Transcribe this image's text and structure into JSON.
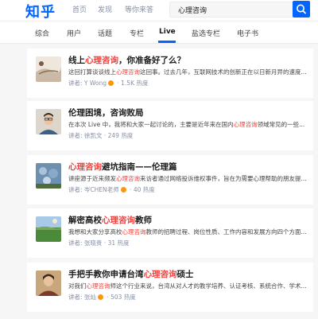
{
  "header": {
    "logo": "知乎",
    "nav": [
      "首页",
      "发现",
      "等你来答"
    ],
    "search": {
      "value": "心理咨询"
    }
  },
  "tabs": [
    "综合",
    "用户",
    "话题",
    "专栏",
    "Live",
    "盐选专栏",
    "电子书"
  ],
  "active_tab": "Live",
  "meta_labels": {
    "speaker_prefix": "讲者:",
    "dot": "·",
    "heat_suffix": "热度"
  },
  "results": [
    {
      "title_pre": "线上",
      "title_hl": "心理咨询",
      "title_post": "，你准备好了么？",
      "desc_pre": "这回打算谈谈线上",
      "desc_hl": "心理咨询",
      "desc_post": "这回事。过去几年，互联网技术的创新正在以日新月异的速度...",
      "speaker": "Y Wong",
      "badge": true,
      "heat": "1.5K",
      "thumb_icon": "curve-landscape-icon"
    },
    {
      "title_pre": "伦理困境，咨询败局",
      "title_hl": "",
      "title_post": "",
      "desc_pre": "在本次 Live 中，我将和大家一起讨论的，主要是近年来在国内",
      "desc_hl": "心理咨询",
      "desc_post": "领域常见的一些...",
      "speaker": "徐凯文",
      "badge": false,
      "heat": "249",
      "thumb_icon": "man-portrait-icon"
    },
    {
      "title_pre": "",
      "title_hl": "心理咨询",
      "title_post": "避坑指南——伦理篇",
      "desc_pre": "讲座源于近来频发",
      "desc_hl": "心理咨询",
      "desc_post": "来访者通过网络投诉维权事件，旨在为需要心理帮助的朋友提...",
      "speaker": "岑CHEN老师",
      "badge": true,
      "heat": "40",
      "thumb_icon": "blue-flowers-icon"
    },
    {
      "title_pre": "解密高校",
      "title_hl": "心理咨询",
      "title_post": "教师",
      "desc_pre": "我想和大家分享高校",
      "desc_hl": "心理咨询",
      "desc_post": "教师的招聘过程、岗位性质、工作内容和发展方向四个方面...",
      "speaker": "张晓贵",
      "badge": false,
      "heat": "31",
      "thumb_icon": "green-field-icon"
    },
    {
      "title_pre": "手把手教你申请台湾",
      "title_hl": "心理咨询",
      "title_post": "硕士",
      "desc_pre": "对我们",
      "desc_hl": "心理咨询",
      "desc_post": "师这个行业来说，台湾从对人才的教学培养、认证考核、系统合作、学术...",
      "speaker": "张灿",
      "badge": true,
      "heat": "503",
      "thumb_icon": "portrait-photo-icon"
    }
  ],
  "colors": {
    "brand": "#0066ff",
    "highlight": "#f1403c",
    "badge": "#ff9607",
    "meta": "#8590a6"
  }
}
